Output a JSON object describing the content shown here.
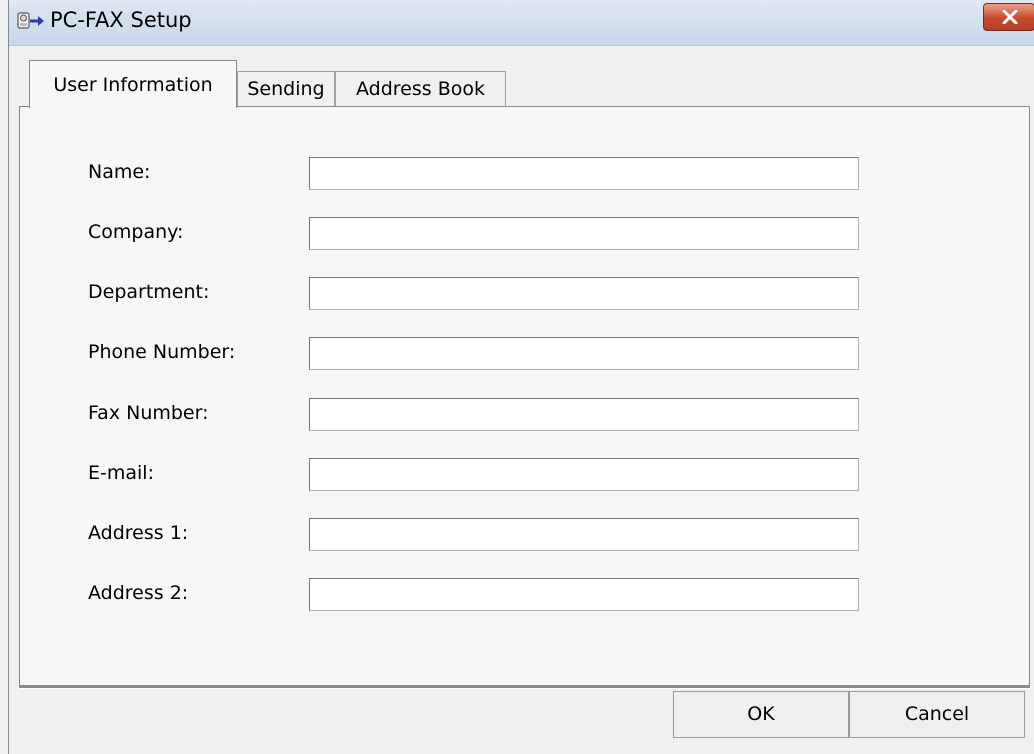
{
  "window": {
    "title": "PC-FAX Setup"
  },
  "tabs": [
    {
      "label": "User Information",
      "active": true
    },
    {
      "label": "Sending",
      "active": false
    },
    {
      "label": "Address Book",
      "active": false
    }
  ],
  "form": {
    "fields": [
      {
        "label": "Name:",
        "value": ""
      },
      {
        "label": "Company:",
        "value": ""
      },
      {
        "label": "Department:",
        "value": ""
      },
      {
        "label": "Phone Number:",
        "value": ""
      },
      {
        "label": "Fax Number:",
        "value": ""
      },
      {
        "label": "E-mail:",
        "value": ""
      },
      {
        "label": "Address 1:",
        "value": ""
      },
      {
        "label": "Address 2:",
        "value": ""
      }
    ]
  },
  "buttons": {
    "ok": "OK",
    "cancel": "Cancel"
  },
  "icons": {
    "app": "fax-arrow-icon",
    "close": "close-icon"
  },
  "colors": {
    "close_button": "#c84a2d",
    "title_icon_arrow": "#2e3fa6"
  }
}
